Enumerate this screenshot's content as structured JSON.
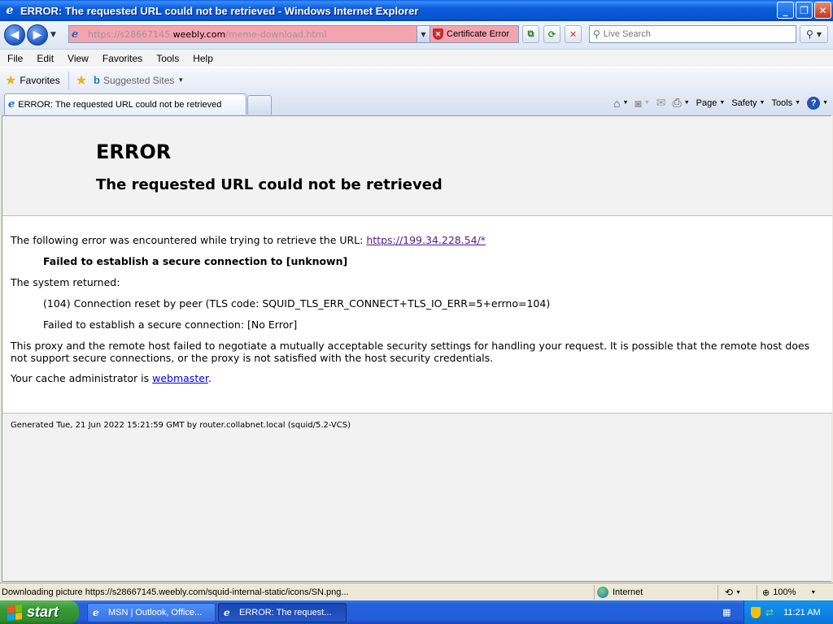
{
  "window": {
    "title": "ERROR: The requested URL could not be retrieved - Windows Internet Explorer",
    "min_glyph": "_",
    "max_glyph": "❐",
    "close_glyph": "✕"
  },
  "address_bar": {
    "url_prefix": "https://s28667145.",
    "url_host": "weebly.com",
    "url_path": "/meme-download.html",
    "cert_error_label": "Certificate Error"
  },
  "search": {
    "placeholder": "Live Search"
  },
  "menu": {
    "items": [
      "File",
      "Edit",
      "View",
      "Favorites",
      "Tools",
      "Help"
    ]
  },
  "favorites_bar": {
    "favorites_label": "Favorites",
    "suggested_label": "Suggested Sites"
  },
  "tabs": {
    "active_label": "ERROR: The requested URL could not be retrieved"
  },
  "command_bar": {
    "page_label": "Page",
    "safety_label": "Safety",
    "tools_label": "Tools"
  },
  "page": {
    "heading": "ERROR",
    "subheading": "The requested URL could not be retrieved",
    "intro_text": "The following error was encountered while trying to retrieve the URL: ",
    "intro_link": "https://199.34.228.54/*",
    "error_line": "Failed to establish a secure connection to [unknown]",
    "system_returned": "The system returned:",
    "system_error_1": "(104) Connection reset by peer (TLS code: SQUID_TLS_ERR_CONNECT+TLS_IO_ERR=5+errno=104)",
    "system_error_2": "Failed to establish a secure connection: [No Error]",
    "explanation": "This proxy and the remote host failed to negotiate a mutually acceptable security settings for handling your request. It is possible that the remote host does not support secure connections, or the proxy is not satisfied with the host security credentials.",
    "admin_prefix": "Your cache administrator is ",
    "admin_link": "webmaster",
    "admin_suffix": ".",
    "generated": "Generated Tue, 21 Jun 2022 15:21:59 GMT by router.collabnet.local (squid/5.2-VCS)"
  },
  "status_bar": {
    "status_text": "Downloading picture https://s28667145.weebly.com/squid-internal-static/icons/SN.png...",
    "zone_label": "Internet",
    "zoom_label": "100%"
  },
  "taskbar": {
    "start_label": "start",
    "task1_label": "MSN | Outlook, Office...",
    "task2_label": "ERROR: The request...",
    "clock": "11:21 AM"
  },
  "colors": {
    "cert_error_bg": "#f5a3ae",
    "link_visited": "#551a8b",
    "link": "#0000ee",
    "titlebar": "#0b5cdc"
  }
}
